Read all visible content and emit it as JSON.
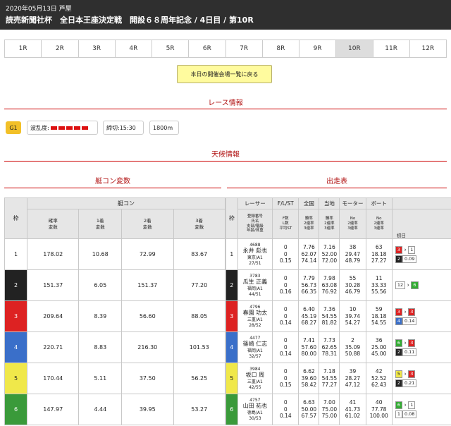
{
  "header": {
    "date_line": "2020年05月13日 芦屋",
    "title": "読売新聞社杯　全日本王座決定戦　開設６８周年記念 / 4日目 / 第10R"
  },
  "tabs": [
    "1R",
    "2R",
    "3R",
    "4R",
    "5R",
    "6R",
    "7R",
    "8R",
    "9R",
    "10R",
    "11R",
    "12R"
  ],
  "back_button": "本日の開催会場一覧に戻る",
  "section_race": "レース情報",
  "race": {
    "grade": "G1",
    "wave_label": "波乱度:",
    "deadline": "締切:15:30",
    "distance": "1800m"
  },
  "section_weather": "天候情報",
  "section_motor": "艇コン変数",
  "section_entry": "出走表",
  "left_table": {
    "h_waku": "枠",
    "h_group": "艇コン",
    "h_cols": [
      "確率\n変数",
      "1着\n変数",
      "2着\n変数",
      "3着\n変数"
    ],
    "rows": [
      {
        "w": "1",
        "v": [
          "178.02",
          "10.68",
          "72.99",
          "83.67"
        ]
      },
      {
        "w": "2",
        "v": [
          "151.37",
          "6.05",
          "151.37",
          "77.20"
        ]
      },
      {
        "w": "3",
        "v": [
          "209.64",
          "8.39",
          "56.60",
          "88.05"
        ]
      },
      {
        "w": "4",
        "v": [
          "220.71",
          "8.83",
          "216.30",
          "101.53"
        ]
      },
      {
        "w": "5",
        "v": [
          "170.44",
          "5.11",
          "37.50",
          "56.25"
        ]
      },
      {
        "w": "6",
        "v": [
          "147.97",
          "4.44",
          "39.95",
          "53.27"
        ]
      }
    ]
  },
  "right_table": {
    "h_waku": "枠",
    "h_top": [
      "レーサー",
      "F/L/ST",
      "全国",
      "当地",
      "モーター",
      "ボート"
    ],
    "h_sub": [
      "登録番号\n氏名\n支部/階級\n年齢/体重",
      "F数\nL数\n平均ST",
      "勝率\n2連率\n3連率",
      "勝率\n2連率\n3連率",
      "No\n2連率\n3連率",
      "No\n2連率\n3連率"
    ],
    "h_first": "初日",
    "rows": [
      {
        "w": "1",
        "id": "4688",
        "name": "永井 彪也",
        "branch": "東京/A1",
        "age": "27/51",
        "fl": "0\n0\n0.15",
        "nat": "7.76\n62.07\n74.14",
        "loc": "7.16\n52.00\n72.00",
        "mot": "38\n29.47\n48.79",
        "boat": "63\n18.18\n27.27",
        "f1": "3",
        "f2": "1",
        "f3": "2",
        "f4": "0.09"
      },
      {
        "w": "2",
        "id": "3783",
        "name": "瓜生 正義",
        "branch": "福岡/A1",
        "age": "44/51",
        "fl": "0\n0\n0.16",
        "nat": "7.79\n56.73\n66.35",
        "loc": "7.98\n63.08\n76.92",
        "mot": "55\n30.28\n46.79",
        "boat": "11\n33.33\n55.56",
        "f1": "12",
        "f2": "6",
        "f3": "",
        "f4": ""
      },
      {
        "w": "3",
        "id": "4796",
        "name": "春園 功太",
        "branch": "三重/A1",
        "age": "28/52",
        "fl": "0\n0\n0.14",
        "nat": "6.40\n45.19\n68.27",
        "loc": "7.36\n54.55\n81.82",
        "mot": "10\n39.74\n54.27",
        "boat": "59\n18.18\n54.55",
        "f1": "3",
        "f2": "3",
        "f3": "4",
        "f4": "0.14"
      },
      {
        "w": "4",
        "id": "4477",
        "name": "篠崎 仁志",
        "branch": "福岡/A1",
        "age": "32/57",
        "fl": "0\n0\n0.14",
        "nat": "7.41\n57.60\n80.00",
        "loc": "7.73\n62.65\n78.31",
        "mot": "2\n35.09\n50.88",
        "boat": "36\n25.00\n45.00",
        "f1": "6",
        "f2": "3",
        "f3": "2",
        "f4": "0.11"
      },
      {
        "w": "5",
        "id": "3984",
        "name": "坂口 周",
        "branch": "三重/A1",
        "age": "42/55",
        "fl": "0\n0\n0.15",
        "nat": "6.62\n39.60\n58.42",
        "loc": "7.18\n54.55\n77.27",
        "mot": "39\n28.27\n47.12",
        "boat": "42\n52.52\n62.43",
        "f1": "5",
        "f2": "3",
        "f3": "2",
        "f4": "0.21"
      },
      {
        "w": "6",
        "id": "4757",
        "name": "山田 祐也",
        "branch": "徳島/A1",
        "age": "30/53",
        "fl": "0\n0\n0.14",
        "nat": "6.63\n50.00\n67.57",
        "loc": "7.00\n75.00\n75.00",
        "mot": "41\n41.73\n61.02",
        "boat": "40\n77.78\n100.00",
        "f1": "6",
        "f2": "1",
        "f3": "1",
        "f4": "0.08"
      }
    ]
  },
  "colors": {
    "w1": "#ffffff",
    "w2": "#222222",
    "w3": "#dd2222",
    "w4": "#3a6fc9",
    "w5": "#f0e84a",
    "w6": "#3a9a3a"
  }
}
